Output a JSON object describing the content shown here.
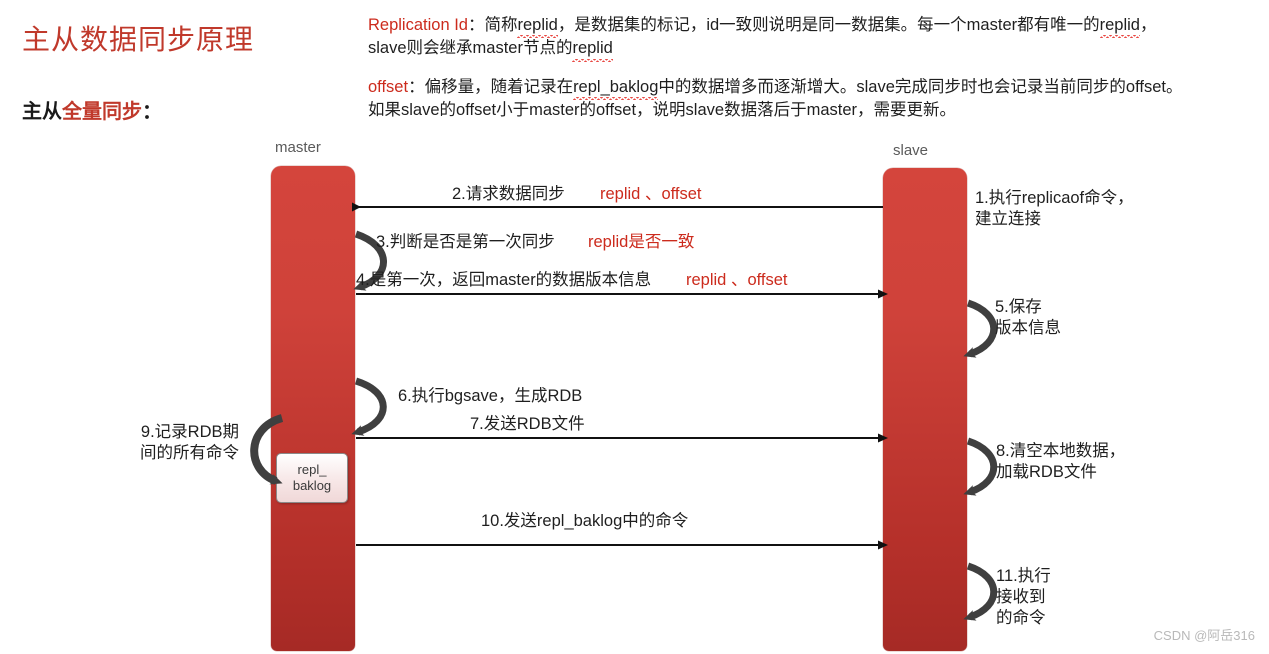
{
  "header": {
    "title": "主从数据同步原理",
    "subtitle_prefix": "主从",
    "subtitle_highlight": "全量同步",
    "subtitle_suffix": "："
  },
  "description": {
    "para1": {
      "key": "Replication Id",
      "line1_a": "：简称",
      "line1_b": "replid",
      "line1_c": "，是数据集的标记，id一致则说明是同一数据集。每一个master都有唯一的",
      "line1_d": "replid",
      "line1_e": "，",
      "line2_a": "slave则会继承master节点的",
      "line2_b": "replid"
    },
    "para2": {
      "key": "offset",
      "line1_a": "：偏移量，随着记录在",
      "line1_b": "repl_baklog",
      "line1_c": "中的数据增多而逐渐增大。slave完成同步时也会记录当前同步的offset。",
      "line2": "如果slave的offset小于master的offset，说明slave数据落后于master，需要更新。"
    }
  },
  "diagram": {
    "master_label": "master",
    "slave_label": "slave",
    "baklog_line1": "repl_",
    "baklog_line2": "baklog",
    "steps": {
      "s1": "1.执行replicaof命令，\n建立连接",
      "s1_underline": "replicaof",
      "s2": "2.请求数据同步",
      "s2_red": "replid 、offset",
      "s3": "3.判断是否是第一次同步",
      "s3_red": "replid是否一致",
      "s4": "4.是第一次，返回master的数据版本信息",
      "s4_red": "replid 、offset",
      "s5": "5.保存\n版本信息",
      "s6": "6.执行bgsave，生成RDB",
      "s7": "7.发送RDB文件",
      "s8": "8.清空本地数据，\n加载RDB文件",
      "s9": "9.记录RDB期\n间的所有命令",
      "s10": "10.发送repl_baklog中的命令",
      "s11": "11.执行\n接收到\n的命令"
    }
  },
  "watermark": "CSDN @阿岳316",
  "colors": {
    "accent_red": "#c0392b",
    "key_red": "#cc2b1d",
    "node_red_top": "#d4453c",
    "node_red_bottom": "#a62a25",
    "arrow_gray": "#3f3f3f",
    "arrow_black": "#111111"
  }
}
